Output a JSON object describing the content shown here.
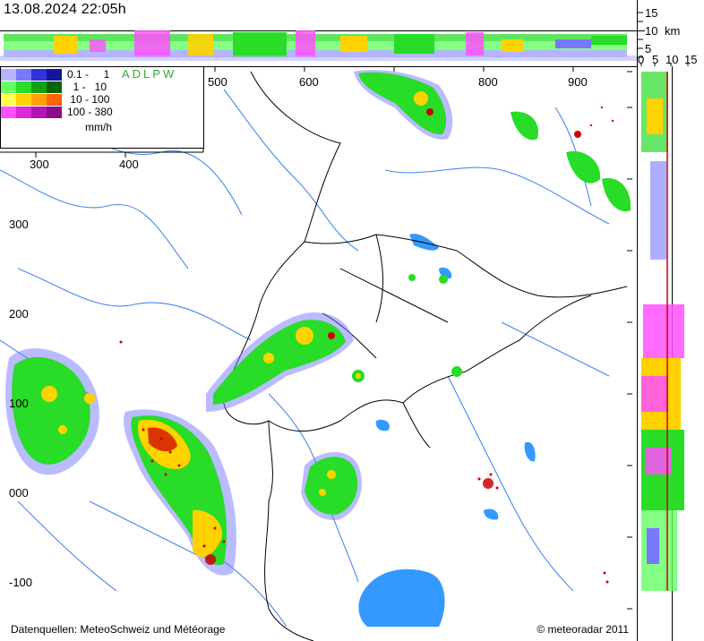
{
  "timestamp": "13.08.2024 22:05h",
  "credits": {
    "left": "Datenquellen: MeteoSchweiz und Météorage",
    "right": "© meteoradar 2011"
  },
  "legend": {
    "rows": [
      {
        "label": "0.1 -     1",
        "colors": [
          "#b4b4ff",
          "#7878ff",
          "#3232dc",
          "#1414a0"
        ]
      },
      {
        "label": "  1 -   10",
        "colors": [
          "#64ff64",
          "#28dc28",
          "#14a014",
          "#0a640a"
        ]
      },
      {
        "label": " 10 - 100",
        "colors": [
          "#ffff50",
          "#ffd200",
          "#ffa000",
          "#ff6400"
        ]
      },
      {
        "label": "100 - 380",
        "colors": [
          "#ff50ff",
          "#dc28dc",
          "#b414b4",
          "#8c0a8c"
        ]
      }
    ],
    "unit": "mm/h",
    "stations": "ADLPW"
  },
  "axes": {
    "x_ticks": [
      "300",
      "400",
      "500",
      "600",
      "800",
      "900"
    ],
    "y_ticks": [
      "300",
      "200",
      "100",
      "000",
      "-100"
    ],
    "height_ticks": [
      "15",
      "10",
      "5",
      "0"
    ],
    "height_unit": "km",
    "side_ticks": [
      "0",
      "5",
      "10",
      "15"
    ]
  },
  "colors": {
    "water": "#3399ff",
    "rivers": "#4488ee",
    "borders": "#000000",
    "rain_light": "#7878ff",
    "rain_moderate": "#28dc28",
    "rain_heavy": "#ffd200",
    "rain_extreme": "#ff50ff",
    "lightning": "#cc0000"
  }
}
